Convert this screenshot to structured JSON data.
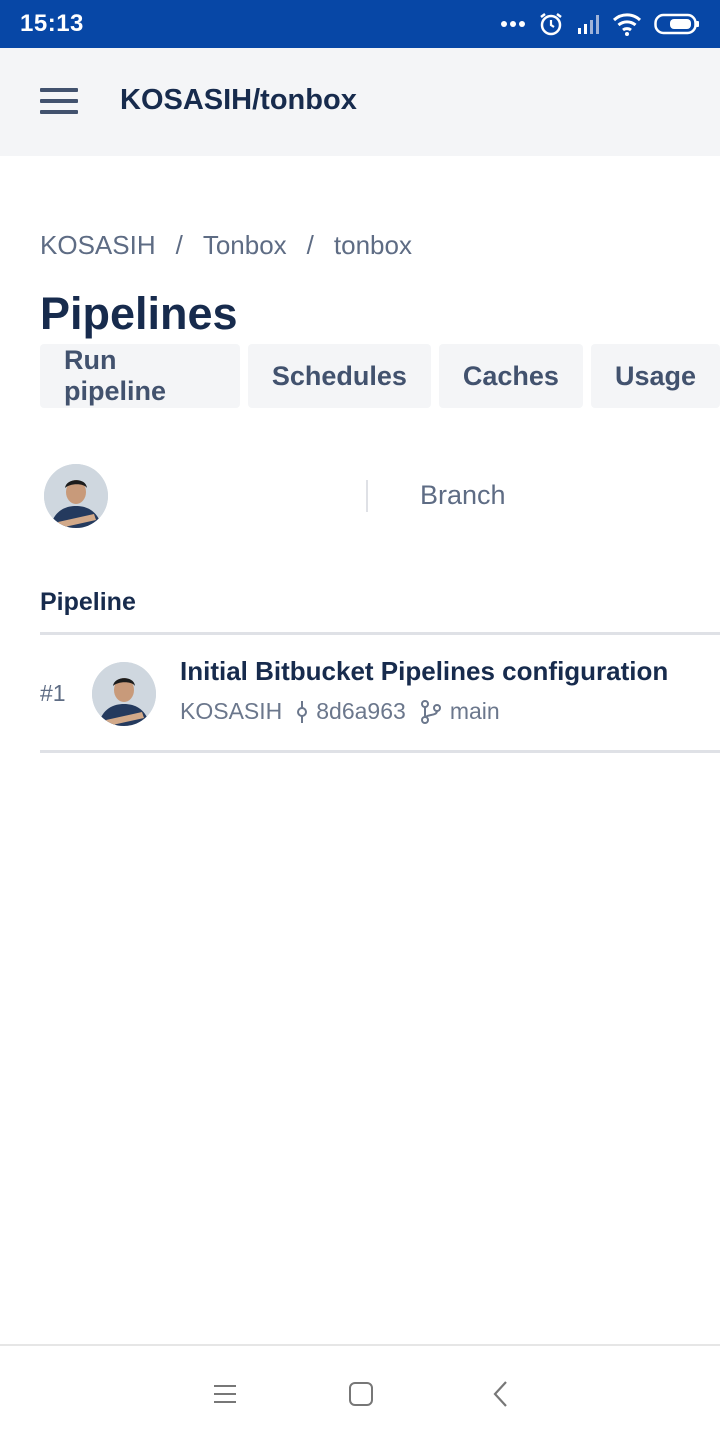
{
  "status_bar": {
    "time": "15:13",
    "icons": [
      "more-dots-icon",
      "alarm-icon",
      "signal-icon",
      "wifi-icon",
      "battery-icon"
    ],
    "background_color": "#0747a6"
  },
  "header": {
    "title": "KOSASIH/tonbox",
    "menu_icon": "hamburger-menu-icon"
  },
  "breadcrumb": {
    "items": [
      "KOSASIH",
      "Tonbox",
      "tonbox"
    ],
    "separator": "/"
  },
  "page": {
    "title": "Pipelines"
  },
  "actions": [
    "Run pipeline",
    "Schedules",
    "Caches",
    "Usage"
  ],
  "filters": {
    "user_icon": "user-avatar",
    "branch_label": "Branch"
  },
  "table": {
    "header": "Pipeline",
    "rows": [
      {
        "number": "#1",
        "title": "Initial Bitbucket Pipelines configuration",
        "author": "KOSASIH",
        "commit": "8d6a963",
        "branch": "main"
      }
    ]
  },
  "nav_bar": {
    "icons": [
      "recent-apps-icon",
      "home-icon",
      "back-icon"
    ]
  },
  "colors": {
    "text_primary": "#172b4d",
    "text_secondary": "#5e6c84",
    "button_bg": "#f4f5f7"
  }
}
